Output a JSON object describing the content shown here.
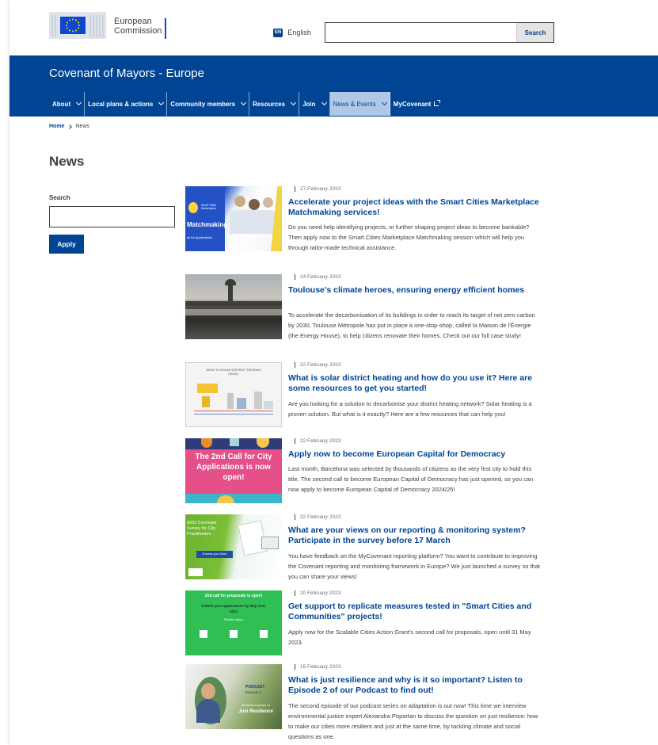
{
  "header": {
    "logo_line1": "European",
    "logo_line2": "Commission",
    "language_code": "EN",
    "language_label": "English",
    "search_button": "Search",
    "site_title": "Covenant of Mayors - Europe"
  },
  "nav": {
    "items": [
      {
        "label": "About"
      },
      {
        "label": "Local plans & actions"
      },
      {
        "label": "Community members"
      },
      {
        "label": "Resources"
      },
      {
        "label": "Join"
      },
      {
        "label": "News & Events"
      },
      {
        "label": "MyCovenant"
      }
    ]
  },
  "breadcrumb": {
    "home": "Home",
    "current": "News"
  },
  "page_title": "News",
  "filter": {
    "label": "Search",
    "apply": "Apply"
  },
  "thumb_text": {
    "t1_small": "Smart Cities Marketplace",
    "t1_big": "Matchmaking",
    "t1_sub": "all for Applications",
    "t3_title": "WHAT IS SOLAR DISTRICT HEATING (SDH)?",
    "t4_text": "The 2nd Call for City Applications is now open!",
    "t5_title": "2023 Covenant Survey for City Practitioners",
    "t5_btn": "Express your Views",
    "t6_title": "2nd call for proposals is open!",
    "t6_sub": "Submit your applications by May 31st, 2023",
    "t6_topics": "Priority topics",
    "t7_podcast": "PODCAST",
    "t7_episode": "Episode 2",
    "t7_name": "Alexandra Popartan on",
    "t7_topic": "Just Resilience"
  },
  "news": [
    {
      "date": "27 February 2023",
      "title": "Accelerate your project ideas with the Smart Cities Marketplace Matchmaking services!",
      "desc": "Do you need help identifying projects, or further shaping project ideas to become bankable? Then apply now to the Smart Cities Marketplace Matchmaking session which will help you through tailor-made technical assistance."
    },
    {
      "date": "24 February 2023",
      "title": "Toulouse's climate heroes, ensuring energy efficient homes",
      "desc": "To accelerate the decarbonisation of its buildings in order to reach its target of net zero carbon by 2030, Toulouse Métropole has put in place a one-stop-shop, called la Maison de l'Énergie (the Energy House), to help citizens renovate their homes. Check out our full case study!"
    },
    {
      "date": "22 February 2023",
      "title": "What is solar district heating and how do you use it? Here are some resources to get you started!",
      "desc": "Are you looking for a solution to decarbonise your district heating network? Solar heating is a proven solution. But what is it exactly? Here are a few resources that can help you!"
    },
    {
      "date": "22 February 2023",
      "title": "Apply now to become European Capital for Democracy",
      "desc": "Last month, Barcelona was selected by thousands of citizens as the very first city to hold this title. The second call to become European Capital of Democracy has just opened, so you can now apply to become European Capital of Democracy 2024/25!"
    },
    {
      "date": "22 February 2023",
      "title": "What are your views on our reporting & monitoring system? Participate in the survey before 17 March",
      "desc": "You have feedback on the MyCovenant reporting platform? You want to contribute to improving the Covenant reporting and monitoring framework in Europe? We just launched a survey so that you can share your views!"
    },
    {
      "date": "20 February 2023",
      "title": "Get support to replicate measures tested in \"Smart Cities and Communities\" projects!",
      "desc": "Apply now for the Scalable Cities Action Grant's second call for proposals, open until 31 May 2023."
    },
    {
      "date": "15 February 2023",
      "title": "What is just resilience and why is it so important? Listen to Episode 2 of our Podcast to find out!",
      "desc": "The second episode of our podcast series on adaptation is out now! This time we interview environmental justice expert Alexandra Popartan to discuss the question on just resilience: how to make our cities more resilient and just at the same time, by tackling climate and social questions as one."
    }
  ]
}
